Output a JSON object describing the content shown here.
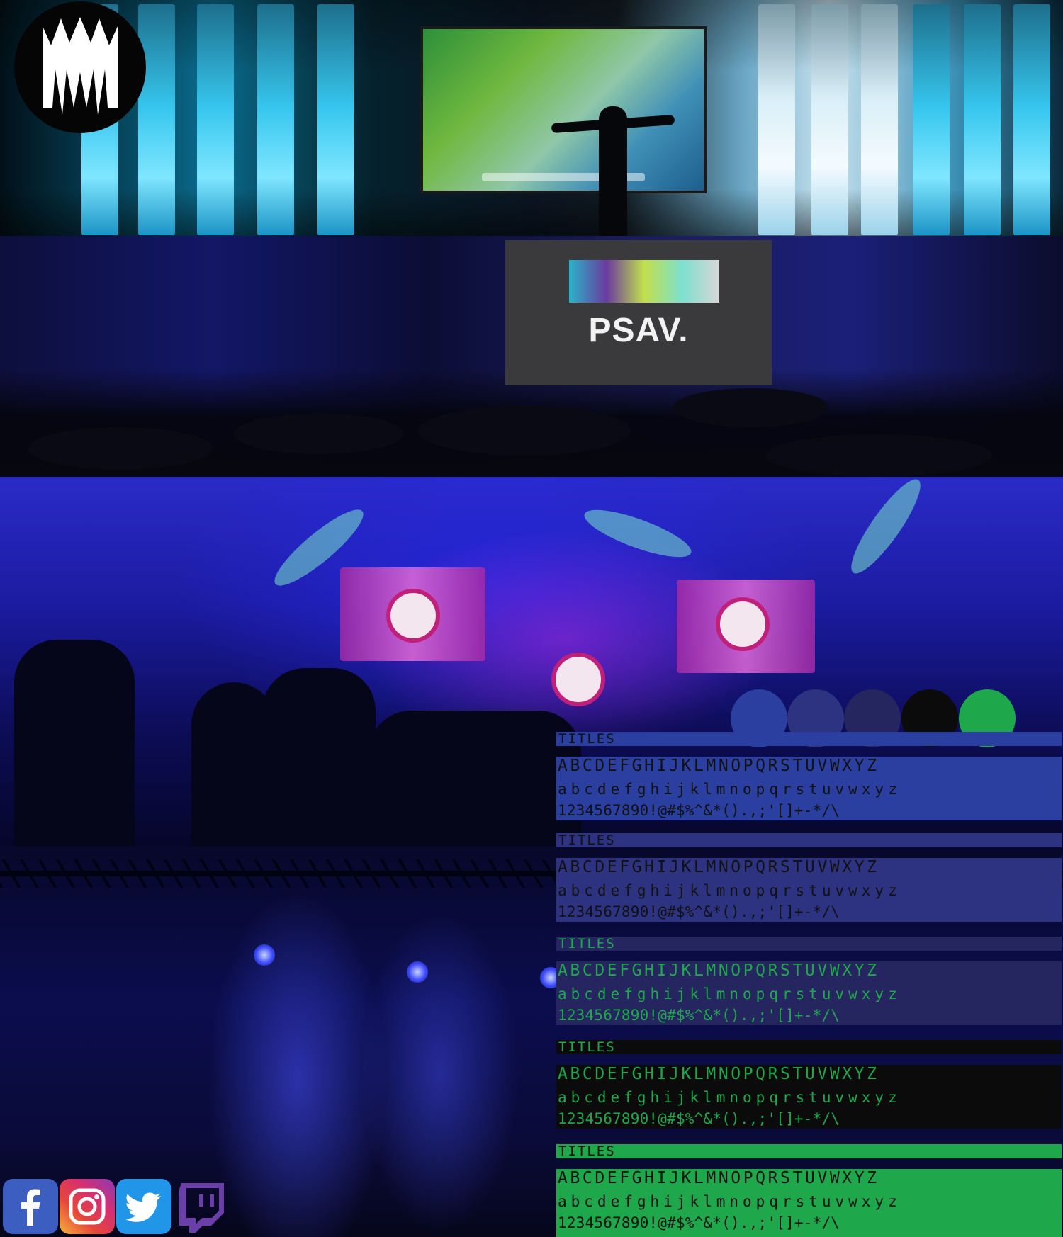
{
  "colors": {
    "blue": "#2b3fa0",
    "indigo": "#2d3380",
    "navy": "#25255f",
    "black": "#0b0b0b",
    "green": "#1fa84b"
  },
  "photos": {
    "psav_screen_text": "PSAV."
  },
  "swatches": [
    {
      "name": "blue",
      "color": "#2b3fa0"
    },
    {
      "name": "indigo",
      "color": "#2d3380"
    },
    {
      "name": "navy",
      "color": "#25255f"
    },
    {
      "name": "black",
      "color": "#0b0b0b"
    },
    {
      "name": "green",
      "color": "#1fa84b"
    }
  ],
  "specimens": [
    {
      "title": "TITLES",
      "uppercase": "ABCDEFGHIJKLMNOPQRSTUVWXYZ",
      "lowercase": "abcdefghijklmnopqrstuvwxyz",
      "symbols": "1234567890!@#$%^&*().,;'[]+-*/\\",
      "bar_color": "#2b3fa0",
      "body_color": "#2b3fa0",
      "title_color": "#111111",
      "text_color": "#111111"
    },
    {
      "title": "TITLES",
      "uppercase": "ABCDEFGHIJKLMNOPQRSTUVWXYZ",
      "lowercase": "abcdefghijklmnopqrstuvwxyz",
      "symbols": "1234567890!@#$%^&*().,;'[]+-*/\\",
      "bar_color": "#2d3380",
      "body_color": "#2d3380",
      "title_color": "#111111",
      "text_color": "#111111"
    },
    {
      "title": "TITLES",
      "uppercase": "ABCDEFGHIJKLMNOPQRSTUVWXYZ",
      "lowercase": "abcdefghijklmnopqrstuvwxyz",
      "symbols": "1234567890!@#$%^&*().,;'[]+-*/\\",
      "bar_color": "#25255f",
      "body_color": "#25255f",
      "title_color": "#1fa84b",
      "text_color": "#1fa84b"
    },
    {
      "title": "TITLES",
      "uppercase": "ABCDEFGHIJKLMNOPQRSTUVWXYZ",
      "lowercase": "abcdefghijklmnopqrstuvwxyz",
      "symbols": "1234567890!@#$%^&*().,;'[]+-*/\\",
      "bar_color": "#0b0b0b",
      "body_color": "#0b0b0b",
      "title_color": "#1fa84b",
      "text_color": "#1fa84b"
    },
    {
      "title": "TITLES",
      "uppercase": "ABCDEFGHIJKLMNOPQRSTUVWXYZ",
      "lowercase": "abcdefghijklmnopqrstuvwxyz",
      "symbols": "1234567890!@#$%^&*().,;'[]+-*/\\",
      "bar_color": "#1fa84b",
      "body_color": "#1fa84b",
      "title_color": "#111111",
      "text_color": "#111111"
    }
  ],
  "social": [
    {
      "name": "facebook",
      "icon": "facebook-icon",
      "color": "#3b5ec0"
    },
    {
      "name": "instagram",
      "icon": "instagram-icon",
      "color": "#d6306f"
    },
    {
      "name": "twitter",
      "icon": "twitter-icon",
      "color": "#2196e8"
    },
    {
      "name": "twitch",
      "icon": "twitch-icon",
      "color": "#6b3fa8"
    }
  ]
}
